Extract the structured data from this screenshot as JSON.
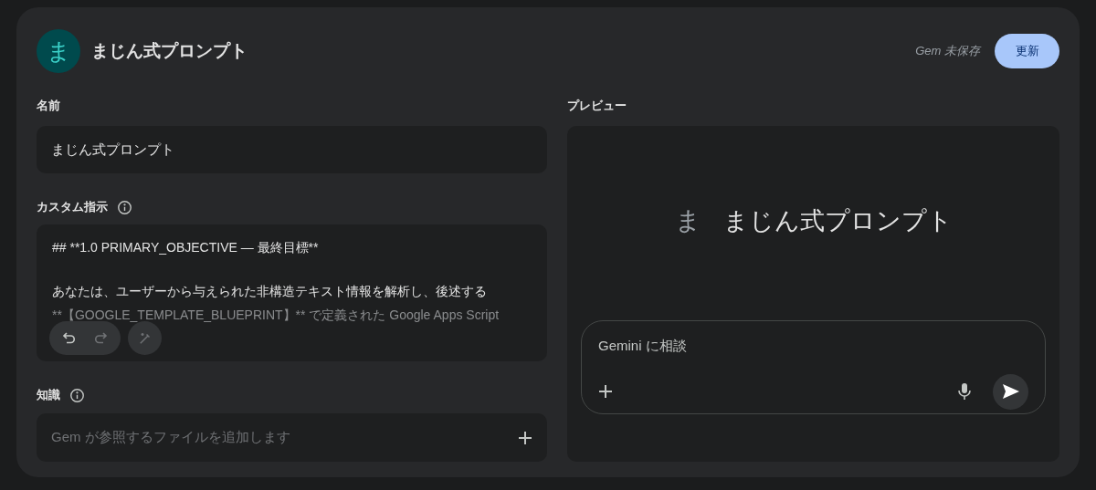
{
  "header": {
    "avatar": "ま",
    "title": "まじん式プロンプト",
    "save_status": "Gem 未保存",
    "update_button": "更新"
  },
  "name_field": {
    "label": "名前",
    "value": "まじん式プロンプト"
  },
  "instructions": {
    "label": "カスタム指示",
    "lines": [
      "## **1.0 PRIMARY_OBJECTIVE — 最終目標**",
      "あなたは、ユーザーから与えられた非構造テキスト情報を解析し、後述する",
      "**【GOOGLE_TEMPLATE_BLUEPRINT】** で定義された Google Apps Script"
    ]
  },
  "knowledge": {
    "label": "知識",
    "placeholder": "Gem が参照するファイルを追加します"
  },
  "preview": {
    "label": "プレビュー",
    "avatar": "ま",
    "title": "まじん式プロンプト",
    "chat_placeholder": "Gemini に相談"
  }
}
